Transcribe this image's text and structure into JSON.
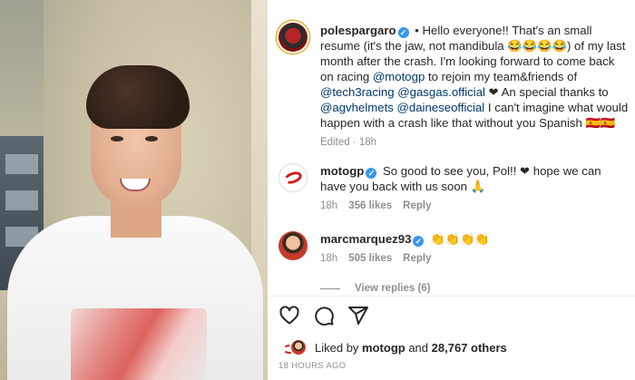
{
  "post": {
    "caption": {
      "username": "polespargaro",
      "parts": [
        {
          "t": "• Hello everyone!! That's an small resume (it's the jaw, not mandibula 😂😂😂😂) of my last month after the crash. I'm looking forward to come back on racing ",
          "m": false
        },
        {
          "t": "@motogp",
          "m": true
        },
        {
          "t": " to rejoin my team&friends of ",
          "m": false
        },
        {
          "t": "@tech3racing",
          "m": true
        },
        {
          "t": " ",
          "m": false
        },
        {
          "t": "@gasgas.official",
          "m": true
        },
        {
          "t": " ❤ An special thanks to ",
          "m": false
        },
        {
          "t": "@agvhelmets",
          "m": true
        },
        {
          "t": " ",
          "m": false
        },
        {
          "t": "@daineseofficial",
          "m": true
        },
        {
          "t": " I can't imagine what would happen with a crash like that without you Spanish 🇪🇸🇪🇸",
          "m": false
        }
      ],
      "edited_label": "Edited · 18h"
    },
    "comments": [
      {
        "username": "motogp",
        "text": "So good to see you, Pol!! ❤ hope we can have you back with us soon 🙏",
        "time": "18h",
        "likes": "356 likes",
        "reply": "Reply"
      },
      {
        "username": "marcmarquez93",
        "text": "👏👏👏👏",
        "time": "18h",
        "likes": "505 likes",
        "reply": "Reply"
      }
    ],
    "view_replies": "View replies (6)",
    "liked_by": {
      "prefix": "Liked by",
      "user": "motogp",
      "and": "and",
      "others": "28,767 others"
    },
    "timestamp": "18 HOURS AGO"
  },
  "colors": {
    "verified": "#3897f0",
    "mention": "#00376b",
    "muted": "#8e8e8e"
  },
  "icons": [
    "heart-icon",
    "comment-icon",
    "share-icon",
    "verified-badge-icon"
  ]
}
